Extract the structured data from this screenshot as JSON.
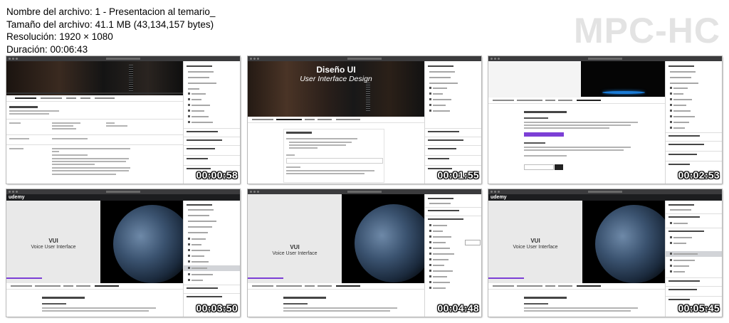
{
  "meta": {
    "filename": "Nombre del archivo: 1 - Presentacion al temario_",
    "filesize": "Tamaño del archivo: 41.1 MB (43,134,157 bytes)",
    "resolution": "Resolución: 1920 × 1080",
    "duration": "Duración: 00:06:43"
  },
  "brand": "MPC-HC",
  "thumbnails": [
    {
      "timestamp": "00:00:58",
      "scene": "course-overview"
    },
    {
      "timestamp": "00:01:55",
      "scene": "title-slide",
      "title": "Diseño UI",
      "subtitle": "User Interface Design"
    },
    {
      "timestamp": "00:02:53",
      "scene": "dark-video"
    },
    {
      "timestamp": "00:03:50",
      "scene": "vui-slide",
      "slide_title": "VUI",
      "slide_subtitle": "Voice User Interface",
      "logo": "udemy"
    },
    {
      "timestamp": "00:04:48",
      "scene": "vui-slide",
      "slide_title": "VUI",
      "slide_subtitle": "Voice User Interface"
    },
    {
      "timestamp": "00:05:45",
      "scene": "vui-slide",
      "slide_title": "VUI",
      "slide_subtitle": "Voice User Interface",
      "logo": "udemy"
    }
  ]
}
